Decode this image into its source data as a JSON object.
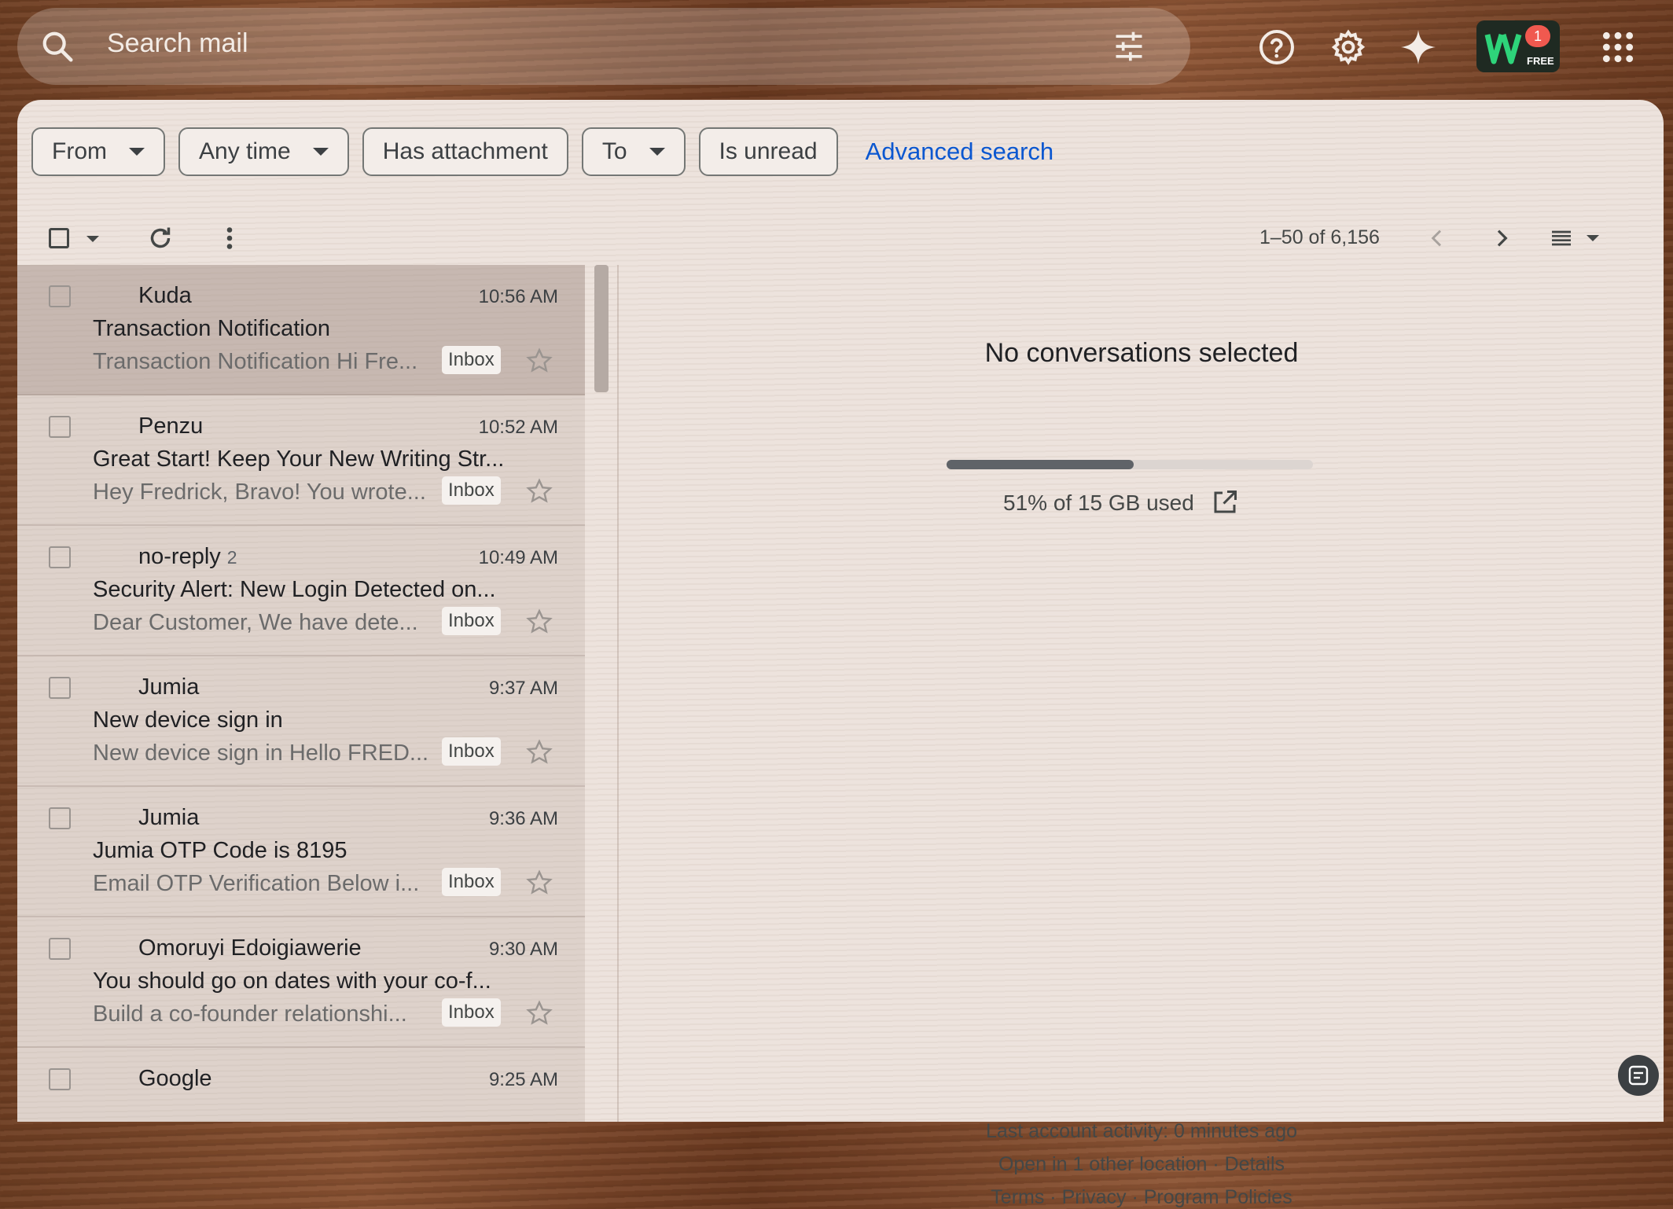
{
  "header": {
    "search_placeholder": "Search mail",
    "icons": [
      "search-icon",
      "tune-icon",
      "help-icon",
      "settings-icon",
      "gemini-icon",
      "apps-icon"
    ],
    "extension": {
      "badge": "1",
      "tag": "FREE"
    }
  },
  "filters": {
    "from": "From",
    "any_time": "Any time",
    "has_attachment": "Has attachment",
    "to": "To",
    "is_unread": "Is unread",
    "advanced": "Advanced search"
  },
  "toolbar": {
    "count": "1–50 of 6,156"
  },
  "emails": [
    {
      "sender": "Kuda",
      "count": "",
      "time": "10:56 AM",
      "subject": "Transaction Notification",
      "snippet": "Transaction Notification Hi Fre...",
      "label": "Inbox"
    },
    {
      "sender": "Penzu",
      "count": "",
      "time": "10:52 AM",
      "subject": "Great Start! Keep Your New Writing Str...",
      "snippet": "Hey Fredrick, Bravo! You wrote...",
      "label": "Inbox"
    },
    {
      "sender": "no-reply",
      "count": "2",
      "time": "10:49 AM",
      "subject": "Security Alert: New Login Detected on...",
      "snippet": "Dear Customer, We have dete...",
      "label": "Inbox"
    },
    {
      "sender": "Jumia",
      "count": "",
      "time": "9:37 AM",
      "subject": "New device sign in",
      "snippet": "New device sign in Hello FRED...",
      "label": "Inbox"
    },
    {
      "sender": "Jumia",
      "count": "",
      "time": "9:36 AM",
      "subject": "Jumia OTP Code is 8195",
      "snippet": "Email OTP Verification Below i...",
      "label": "Inbox"
    },
    {
      "sender": "Omoruyi Edoigiawerie",
      "count": "",
      "time": "9:30 AM",
      "subject": "You should go on dates with your co-f...",
      "snippet": "Build a co-founder relationshi...",
      "label": "Inbox"
    },
    {
      "sender": "Google",
      "count": "",
      "time": "9:25 AM",
      "subject": "",
      "snippet": "",
      "label": ""
    }
  ],
  "reading_pane": {
    "empty_text": "No conversations selected",
    "storage_text": "51% of 15 GB used",
    "storage_fraction": 0.51,
    "activity": "Last account activity: 0 minutes ago",
    "locations": "Open in 1 other location · Details",
    "links": "Terms · Privacy · Program Policies"
  }
}
